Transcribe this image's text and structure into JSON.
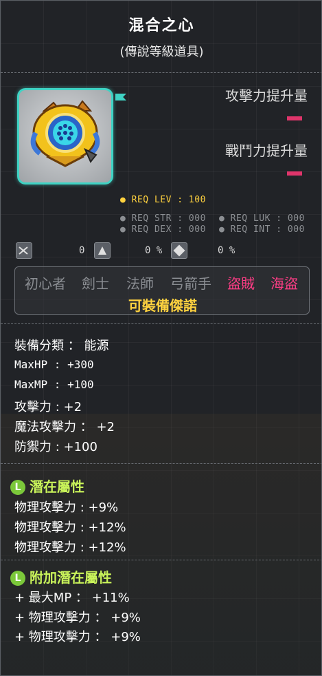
{
  "item": {
    "name": "混合之心",
    "grade": "(傳說等級道具)",
    "icon": "heart-emblem-icon",
    "frame_color": "#3fd3c4"
  },
  "compare": {
    "attack_up": "攻擊力提升量",
    "combat_up": "戰鬥力提升量"
  },
  "requirements": {
    "lev": "● REQ LEV : 100",
    "str": "● REQ STR : 000",
    "dex": "● REQ DEX : 000",
    "luk": "● REQ LUK : 000",
    "int": "● REQ INT : 000"
  },
  "badges": [
    {
      "icon": "scissors-icon",
      "value": "0"
    },
    {
      "icon": "upgrade-hammer-icon",
      "value": "0 %"
    },
    {
      "icon": "star-force-icon",
      "value": "0 %"
    }
  ],
  "jobs": {
    "list": [
      "初心者",
      "劍士",
      "法師",
      "弓箭手",
      "盜賊",
      "海盜"
    ],
    "equip_note": "可裝備傑諾",
    "active_color": "#ff3d86"
  },
  "stats": {
    "category": "裝備分類 ： 能源",
    "maxhp": "MaxHP : +300",
    "maxmp": "MaxMP : +100",
    "atk": "攻擊力 : +2",
    "matk": "魔法攻擊力 ： +2",
    "def": "防禦力 : +100"
  },
  "potential": {
    "title": "潛在屬性",
    "lines": [
      "物理攻擊力 : +9%",
      "物理攻擊力 : +12%",
      "物理攻擊力 : +12%"
    ]
  },
  "bonus_potential": {
    "title": "附加潛在屬性",
    "lines": [
      "+ 最大MP ： +11%",
      "+ 物理攻擊力 ： +9%",
      "+ 物理攻擊力 ： +9%"
    ]
  },
  "colors": {
    "legendary": "#3fd3c4",
    "req_level": "#ffd23f",
    "potential_head": "#c9f35a",
    "compare_dash": "#e0356b"
  }
}
